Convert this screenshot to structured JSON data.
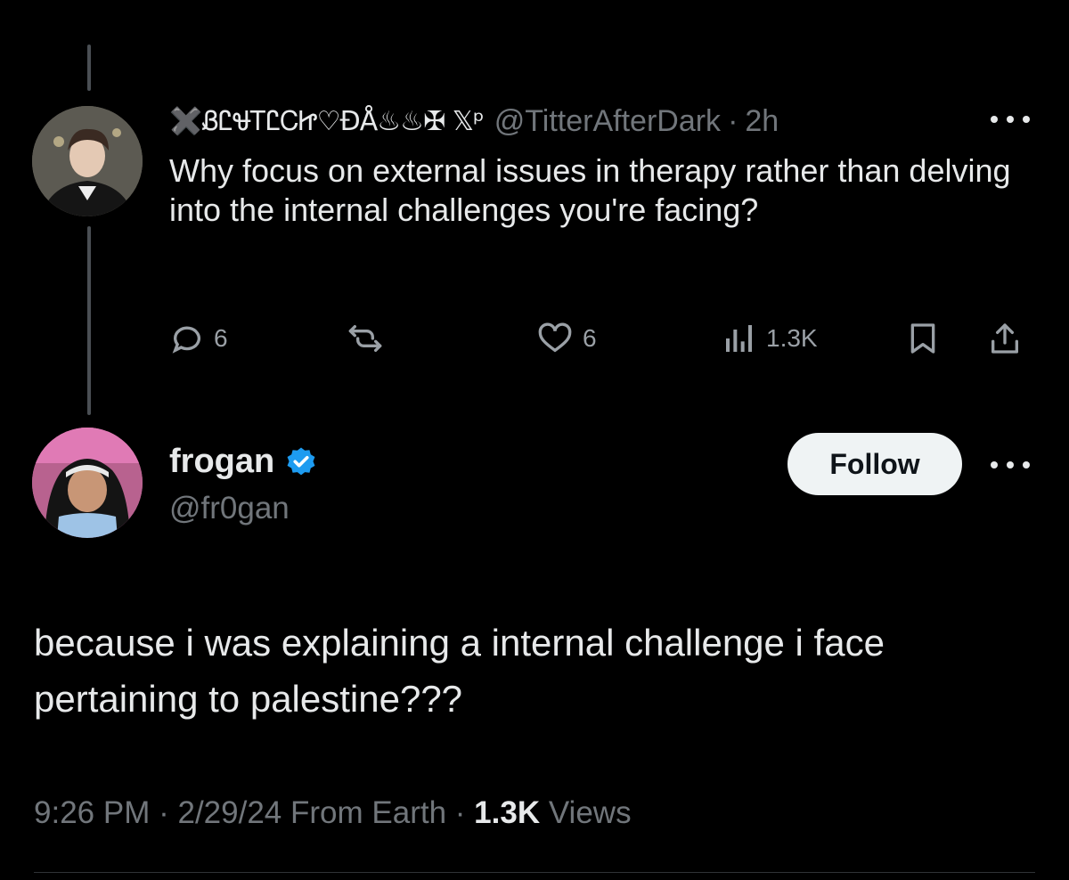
{
  "reply": {
    "display_name": "✖️ᏰᏝᏠᎢᏝᏟᏥ♡ĐÅ♨♨✠ 𝕏ᵖ",
    "handle": "@TitterAfterDark",
    "separator": "·",
    "time": "2h",
    "text": "Why focus on external issues in therapy rather than delving into the internal challenges you're facing?",
    "actions": {
      "replies": "6",
      "reposts": "",
      "likes": "6",
      "views": "1.3K"
    }
  },
  "main": {
    "display_name": "frogan",
    "handle": "@fr0gan",
    "verified": true,
    "follow_label": "Follow",
    "text": "because i was explaining a internal challenge i face pertaining to palestine???",
    "time": "9:26 PM",
    "date": "2/29/24",
    "location": "From Earth",
    "views_count": "1.3K",
    "views_label": "Views",
    "dot": "·"
  },
  "colors": {
    "background": "#000000",
    "text": "#e7e9ea",
    "muted": "#71767b",
    "verified": "#1d9bf0",
    "follow_bg": "#eff3f4"
  },
  "icons": [
    "reply-icon",
    "repost-icon",
    "like-icon",
    "views-icon",
    "bookmark-icon",
    "share-icon",
    "more-icon",
    "verified-badge-icon"
  ]
}
